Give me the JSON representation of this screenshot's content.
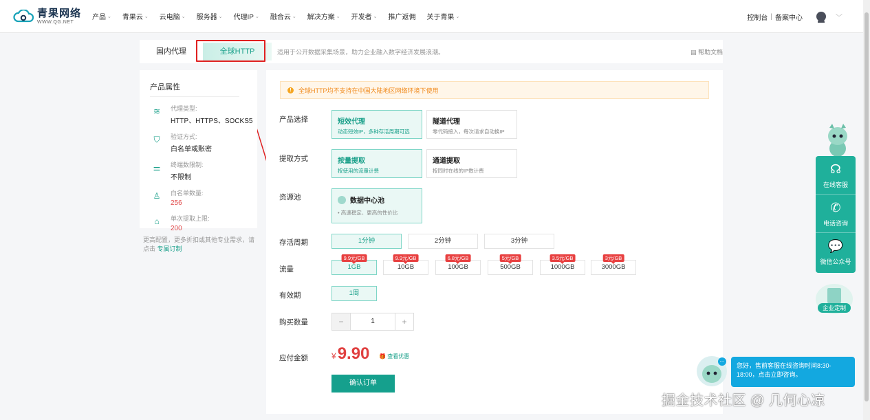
{
  "brand": {
    "name": "青果网络",
    "url_text": "WWW.QG.NET"
  },
  "nav": {
    "items": [
      "产品",
      "青果云",
      "云电脑",
      "服务器",
      "代理IP",
      "融合云",
      "解决方案",
      "开发者",
      "推广返佣",
      "关于青果"
    ],
    "chevrons": [
      true,
      true,
      true,
      true,
      true,
      true,
      true,
      true,
      false,
      true
    ],
    "console": "控制台",
    "separator": "|",
    "beian": "备案中心"
  },
  "tabs": {
    "domestic": "国内代理",
    "global": "全球HTTP",
    "description": "适用于公开数据采集场景，助力企业融入数字经济发展浪潮。",
    "help": "帮助文档"
  },
  "attributes": {
    "title": "产品属性",
    "items": [
      {
        "icon": "layers-icon",
        "label": "代理类型:",
        "value": "HTTP、HTTPS、SOCKS5",
        "highlight": false
      },
      {
        "icon": "shield-check-icon",
        "label": "验证方式:",
        "value": "白名单或账密",
        "highlight": false
      },
      {
        "icon": "sliders-icon",
        "label": "终端数限制:",
        "value": "不限制",
        "highlight": false
      },
      {
        "icon": "user-check-icon",
        "label": "白名单数量:",
        "value": "256",
        "highlight": true
      },
      {
        "icon": "home-arrow-icon",
        "label": "单次提取上限:",
        "value": "200",
        "highlight": true
      }
    ],
    "note": "更高配置，更多折扣或其他专业需求，请点击",
    "note_link": "专属订制"
  },
  "notice": {
    "icon": "!",
    "text": "全球HTTP均不支持在中国大陆地区网络环境下使用"
  },
  "form": {
    "product_label": "产品选择",
    "products": [
      {
        "title": "短效代理",
        "sub": "动态短效IP，多种存活周期可选",
        "selected": true
      },
      {
        "title": "隧道代理",
        "sub": "零代码接入，每次请求自动换IP",
        "selected": false
      }
    ],
    "extract_label": "提取方式",
    "extracts": [
      {
        "title": "按量提取",
        "sub": "按使用的流量计费",
        "selected": true
      },
      {
        "title": "通道提取",
        "sub": "按同时在线的IP数计费",
        "selected": false
      }
    ],
    "pool_label": "资源池",
    "pool": {
      "title": "数据中心池",
      "sub": "• 高速稳定、更高的性价比"
    },
    "period_label": "存活周期",
    "periods": [
      "1分钟",
      "2分钟",
      "3分钟"
    ],
    "period_selected": 0,
    "traffic_label": "流量",
    "traffic": [
      {
        "size": "1GB",
        "price": "9.9元/GB"
      },
      {
        "size": "10GB",
        "price": "9.9元/GB"
      },
      {
        "size": "100GB",
        "price": "6.8元/GB"
      },
      {
        "size": "500GB",
        "price": "5元/GB"
      },
      {
        "size": "1000GB",
        "price": "3.5元/GB"
      },
      {
        "size": "3000GB",
        "price": "3元/GB"
      }
    ],
    "traffic_selected": 0,
    "validity_label": "有效期",
    "validity": "1周",
    "quantity_label": "购买数量",
    "quantity": "1",
    "minus": "−",
    "plus": "+",
    "amount_label": "应付金额",
    "currency": "¥",
    "amount": "9.90",
    "discount": "查看优惠",
    "confirm": "确认订单"
  },
  "side": {
    "online_service": "在线客服",
    "phone": "电话咨询",
    "wechat": "微信公众号",
    "custom": "企业定制"
  },
  "chat": {
    "message": "您好，售前客服在线咨询时间8:30-18:00，点击立即咨询。"
  },
  "watermark": "掘金技术社区 @ 几何心凉",
  "colors": {
    "accent": "#1aa08a",
    "accent_bg": "#eaf8f5",
    "price": "#e04040",
    "annotation": "#e02020"
  }
}
